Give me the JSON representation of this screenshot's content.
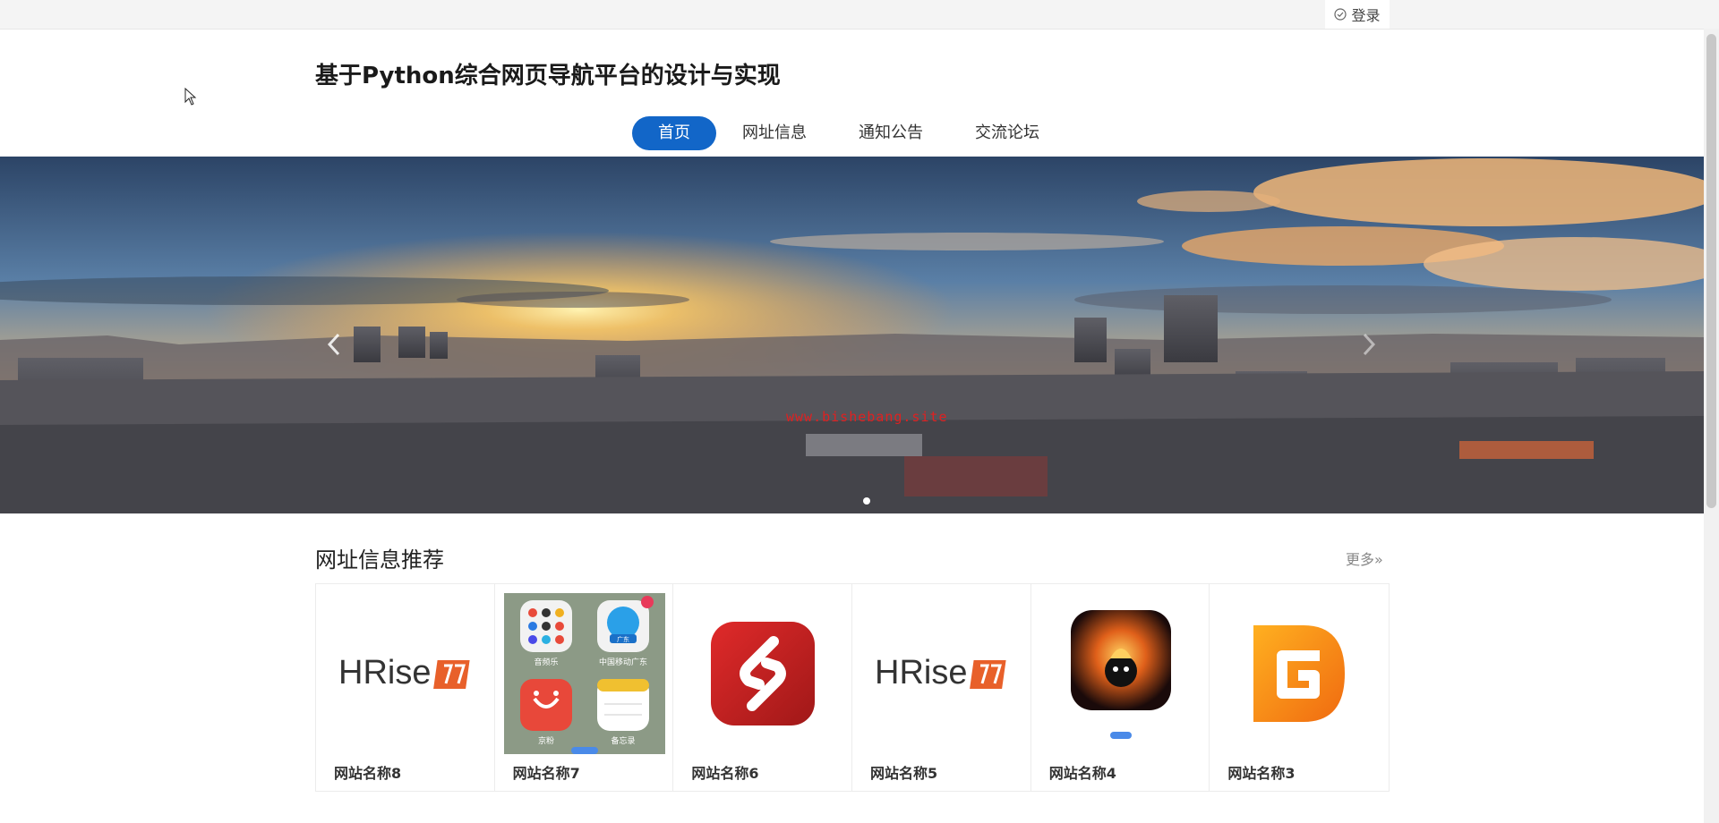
{
  "topbar": {
    "login_label": "登录"
  },
  "site": {
    "title": "基于Python综合网页导航平台的设计与实现"
  },
  "nav": {
    "items": [
      {
        "label": "首页",
        "active": true
      },
      {
        "label": "网址信息",
        "active": false
      },
      {
        "label": "通知公告",
        "active": false
      },
      {
        "label": "交流论坛",
        "active": false
      }
    ]
  },
  "banner": {
    "watermark": "www.bishebang.site",
    "slide_count": 1,
    "active_slide": 1
  },
  "recommend": {
    "title": "网址信息推荐",
    "more_label": "更多»",
    "cards": [
      {
        "name": "网站名称8",
        "icon": "hrise-logo"
      },
      {
        "name": "网站名称7",
        "icon": "phone-apps-screenshot",
        "app_labels": [
          "音频乐",
          "中国移动广东",
          "京粉",
          "备忘录"
        ],
        "badge": "广东"
      },
      {
        "name": "网站名称6",
        "icon": "red-s-app-icon"
      },
      {
        "name": "网站名称5",
        "icon": "hrise-logo"
      },
      {
        "name": "网站名称4",
        "icon": "game-character-icon"
      },
      {
        "name": "网站名称3",
        "icon": "orange-g-app-icon"
      }
    ],
    "hrise_text": "HRise"
  },
  "colors": {
    "accent": "#1266c8",
    "watermark": "#e02020"
  }
}
